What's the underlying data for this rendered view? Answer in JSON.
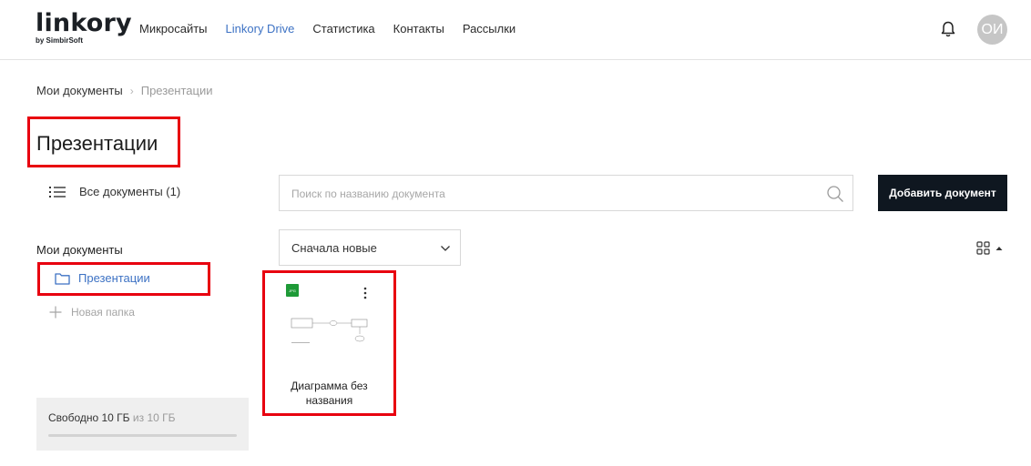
{
  "header": {
    "logo": {
      "main": "linkory",
      "sub": "by SimbirSoft"
    },
    "nav": [
      {
        "label": "Микросайты",
        "active": false
      },
      {
        "label": "Linkory Drive",
        "active": true
      },
      {
        "label": "Статистика",
        "active": false
      },
      {
        "label": "Контакты",
        "active": false
      },
      {
        "label": "Рассылки",
        "active": false
      }
    ],
    "avatar_initials": "ОИ"
  },
  "breadcrumb": {
    "root": "Мои документы",
    "separator": "›",
    "current": "Презентации"
  },
  "page_title": "Презентации",
  "sidebar": {
    "all_documents": "Все документы (1)",
    "section_heading": "Мои документы",
    "folders": [
      {
        "label": "Презентации",
        "active": true
      }
    ],
    "new_folder": "Новая папка",
    "storage": {
      "free": "Свободно 10 ГБ",
      "total": "из 10 ГБ",
      "used_fraction": 0
    }
  },
  "toolbar": {
    "search_placeholder": "Поиск по названию документа",
    "add_button": "Добавить документ",
    "sort_label": "Сначала новые"
  },
  "documents": [
    {
      "badge": "JPG",
      "name": "Диаграмма без названия"
    }
  ],
  "colors": {
    "accent": "#3d72c4",
    "button_dark": "#0f1720",
    "annotation_red": "#e8000f",
    "badge_green": "#1e9a37"
  }
}
